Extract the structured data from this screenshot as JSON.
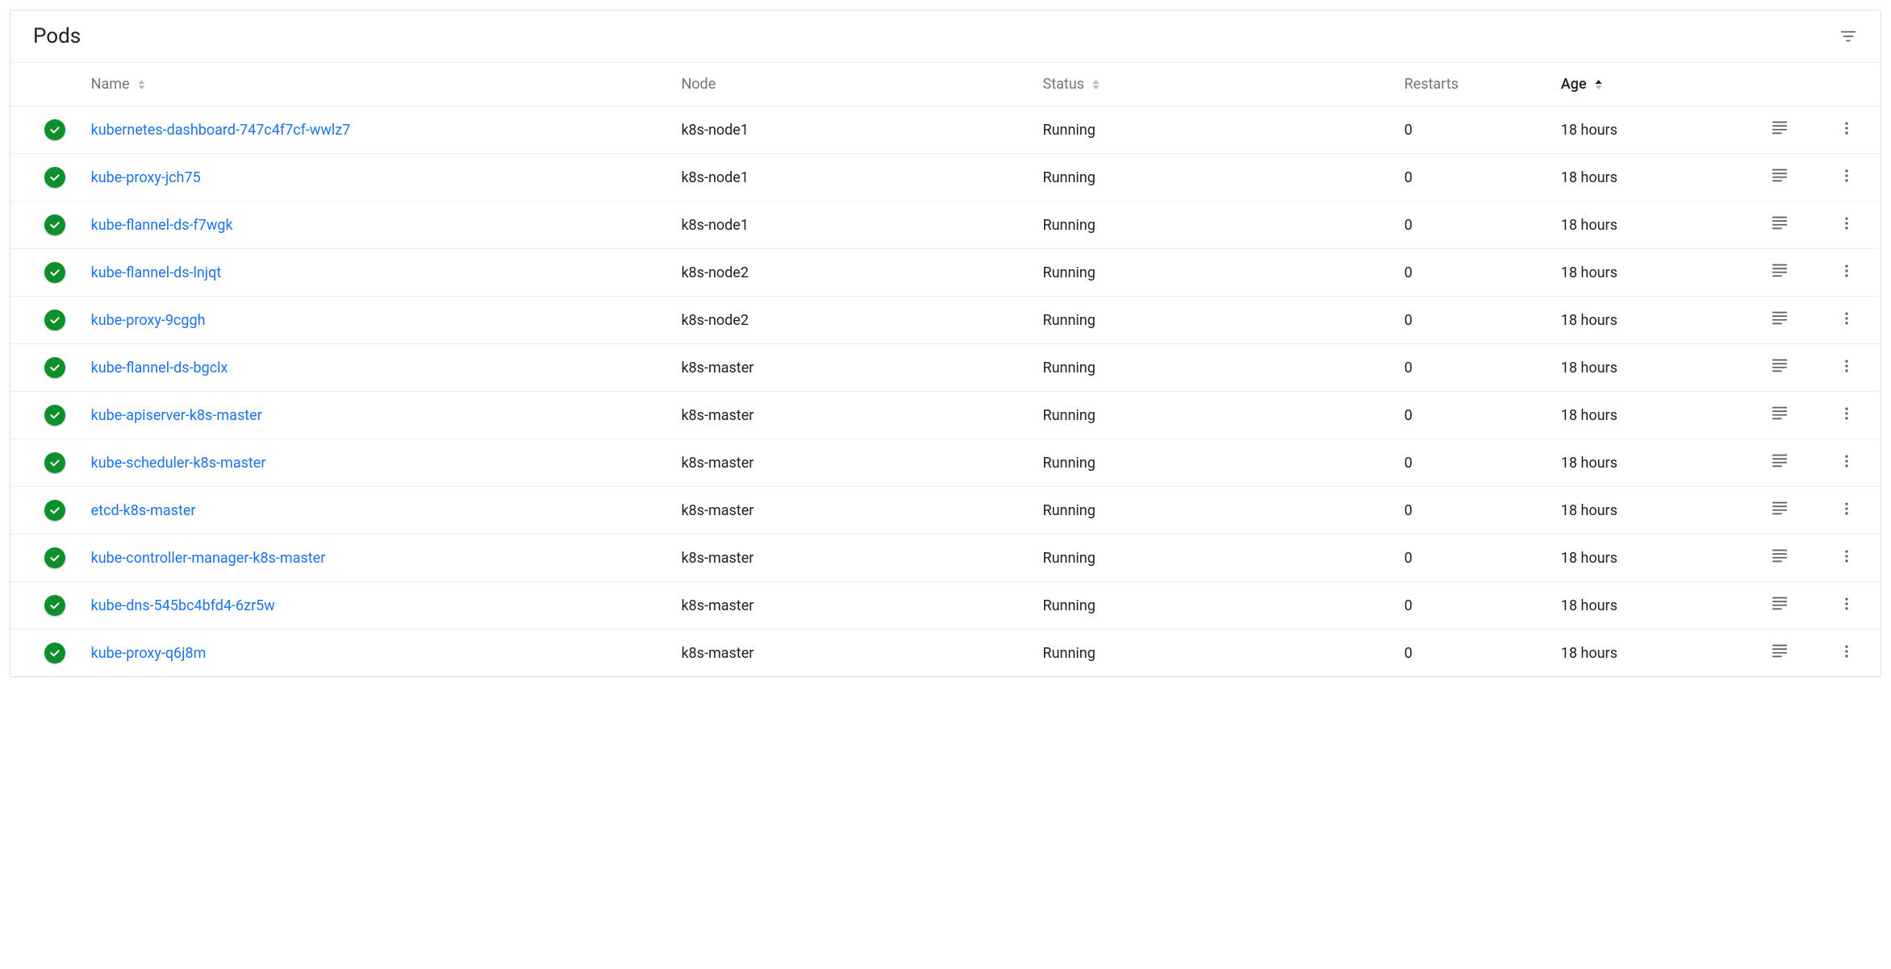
{
  "header": {
    "title": "Pods"
  },
  "columns": {
    "name": "Name",
    "node": "Node",
    "status": "Status",
    "restarts": "Restarts",
    "age": "Age"
  },
  "sortedColumn": "age",
  "rows": [
    {
      "name": "kubernetes-dashboard-747c4f7cf-wwlz7",
      "node": "k8s-node1",
      "status": "Running",
      "restarts": "0",
      "age": "18 hours",
      "health": "ok"
    },
    {
      "name": "kube-proxy-jch75",
      "node": "k8s-node1",
      "status": "Running",
      "restarts": "0",
      "age": "18 hours",
      "health": "ok"
    },
    {
      "name": "kube-flannel-ds-f7wgk",
      "node": "k8s-node1",
      "status": "Running",
      "restarts": "0",
      "age": "18 hours",
      "health": "ok"
    },
    {
      "name": "kube-flannel-ds-lnjqt",
      "node": "k8s-node2",
      "status": "Running",
      "restarts": "0",
      "age": "18 hours",
      "health": "ok"
    },
    {
      "name": "kube-proxy-9cggh",
      "node": "k8s-node2",
      "status": "Running",
      "restarts": "0",
      "age": "18 hours",
      "health": "ok"
    },
    {
      "name": "kube-flannel-ds-bgclx",
      "node": "k8s-master",
      "status": "Running",
      "restarts": "0",
      "age": "18 hours",
      "health": "ok"
    },
    {
      "name": "kube-apiserver-k8s-master",
      "node": "k8s-master",
      "status": "Running",
      "restarts": "0",
      "age": "18 hours",
      "health": "ok"
    },
    {
      "name": "kube-scheduler-k8s-master",
      "node": "k8s-master",
      "status": "Running",
      "restarts": "0",
      "age": "18 hours",
      "health": "ok"
    },
    {
      "name": "etcd-k8s-master",
      "node": "k8s-master",
      "status": "Running",
      "restarts": "0",
      "age": "18 hours",
      "health": "ok"
    },
    {
      "name": "kube-controller-manager-k8s-master",
      "node": "k8s-master",
      "status": "Running",
      "restarts": "0",
      "age": "18 hours",
      "health": "ok"
    },
    {
      "name": "kube-dns-545bc4bfd4-6zr5w",
      "node": "k8s-master",
      "status": "Running",
      "restarts": "0",
      "age": "18 hours",
      "health": "ok"
    },
    {
      "name": "kube-proxy-q6j8m",
      "node": "k8s-master",
      "status": "Running",
      "restarts": "0",
      "age": "18 hours",
      "health": "ok"
    }
  ]
}
